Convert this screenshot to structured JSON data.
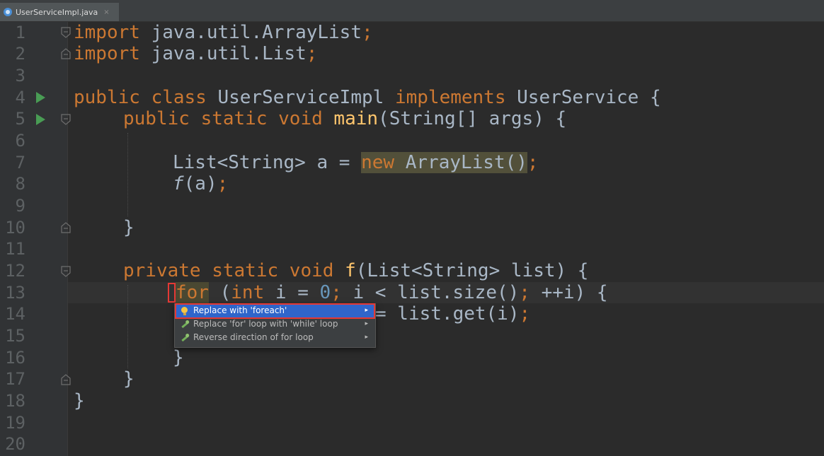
{
  "tab": {
    "filename": "UserServiceImpl.java",
    "close": "×"
  },
  "line_numbers": [
    "1",
    "2",
    "3",
    "4",
    "5",
    "6",
    "7",
    "8",
    "9",
    "10",
    "11",
    "12",
    "13",
    "14",
    "15",
    "16",
    "17",
    "18",
    "19",
    "20"
  ],
  "code": {
    "l1": {
      "kw": "import",
      "rest": " java.util.ArrayList",
      "semi": ";"
    },
    "l2": {
      "kw": "import",
      "rest": " java.util.List",
      "semi": ";"
    },
    "l4": {
      "kw1": "public class",
      "name": " UserServiceImpl ",
      "kw2": "implements",
      "rest": " UserService {"
    },
    "l5": {
      "kw": "public static void",
      "sp": " ",
      "fn": "main",
      "rest": "(String[] args) {"
    },
    "l7": {
      "pre": "List<String> a = ",
      "kw": "new",
      "rest": " ArrayList()",
      "semi": ";"
    },
    "l8": {
      "fn": "f",
      "rest": "(a)",
      "semi": ";"
    },
    "l10": {
      "text": "}"
    },
    "l12": {
      "kw": "private static void",
      "sp": " ",
      "fn": "f",
      "rest": "(List<String> list) {"
    },
    "l13": {
      "kw1": "for",
      "p1": " (",
      "kw2": "int",
      "p2": " i = ",
      "num": "0",
      "semi1": ";",
      "p3": " i < list.size()",
      "semi2": ";",
      "p4": " ++i) {"
    },
    "l14": {
      "rest": "= list.get(i)",
      "semi": ";"
    },
    "l16": {
      "text": "}"
    },
    "l17": {
      "text": "}"
    },
    "l18": {
      "text": "}"
    }
  },
  "popup": {
    "items": [
      {
        "label": "Replace with 'foreach'",
        "icon": "lightbulb-icon",
        "arrow": "▸"
      },
      {
        "label": "Replace 'for' loop with 'while' loop",
        "icon": "wrench-icon",
        "arrow": "▸"
      },
      {
        "label": "Reverse direction of for loop",
        "icon": "wrench-icon",
        "arrow": "▸"
      }
    ]
  },
  "colors": {
    "background": "#2b2b2b",
    "keyword": "#cc7832",
    "function": "#ffc66d",
    "number": "#6897bb",
    "text": "#a9b7c6",
    "selection": "#2f65ca",
    "highlight_box": "#e53935"
  }
}
